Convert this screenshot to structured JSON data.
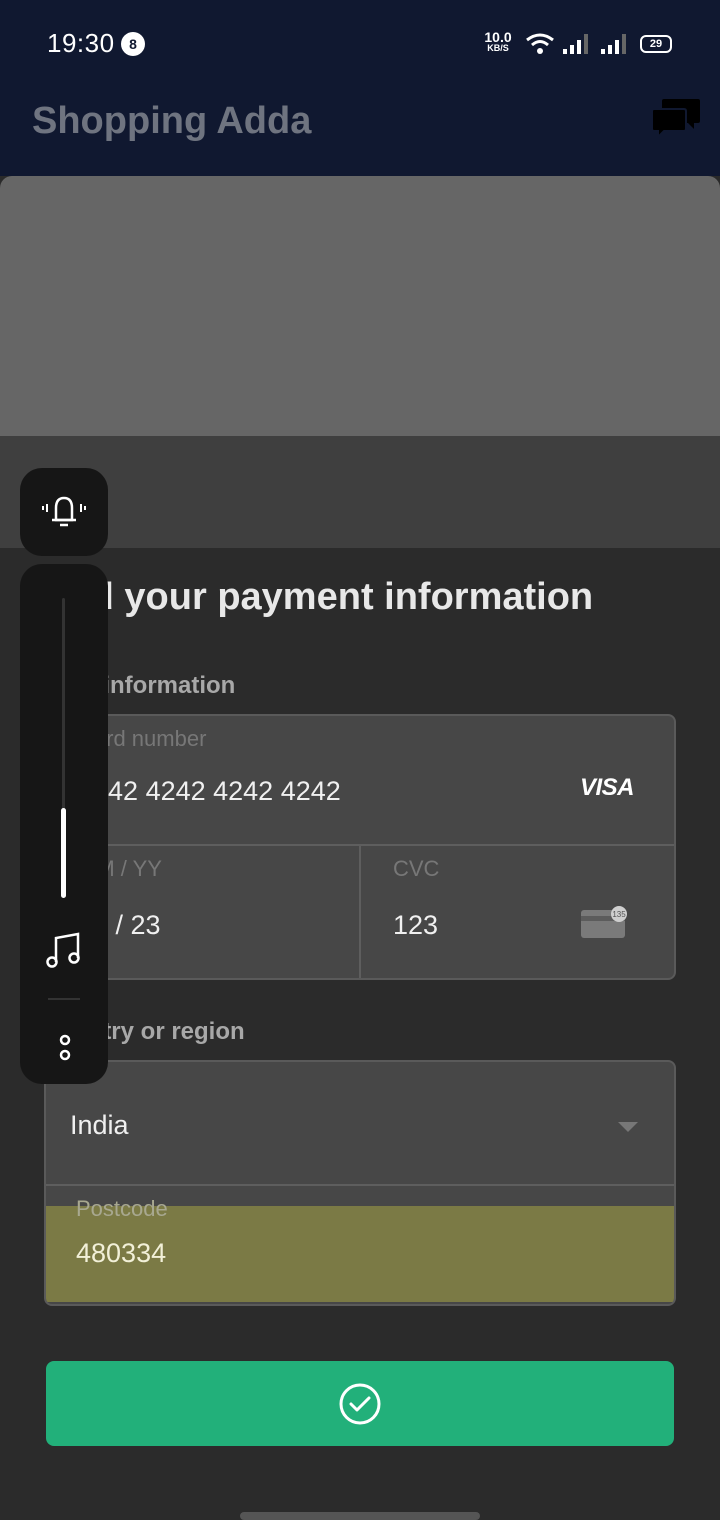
{
  "status_bar": {
    "time": "19:30",
    "notification_count": "8",
    "net_speed_value": "10.0",
    "net_speed_unit": "KB/S",
    "battery": "29"
  },
  "app_bar": {
    "title": "Shopping Adda",
    "chat_icon": "chat-bubbles-icon"
  },
  "payment_sheet": {
    "close_icon": "close-icon",
    "title": "Add your payment information",
    "card_section_label": "Card information",
    "card_number_label": "Card number",
    "card_number_value": "4242 4242 4242 4242",
    "card_brand": "VISA",
    "expiry_label": "MM / YY",
    "expiry_value": "08 / 23",
    "cvc_label": "CVC",
    "cvc_value": "123",
    "cvc_icon_text": "135",
    "country_section_label": "Country or region",
    "country_value": "India",
    "postcode_label": "Postcode",
    "postcode_value": "480334",
    "pay_button_icon": "check-circle-icon"
  },
  "volume_panel": {
    "level": 0.3,
    "ring_icon": "bell-icon",
    "media_icon": "music-note-icon",
    "more_icon": "more-options-icon"
  },
  "colors": {
    "app_bar": "#101830",
    "pay_button": "#22b07a",
    "postcode_highlight": "#7b7a45"
  }
}
